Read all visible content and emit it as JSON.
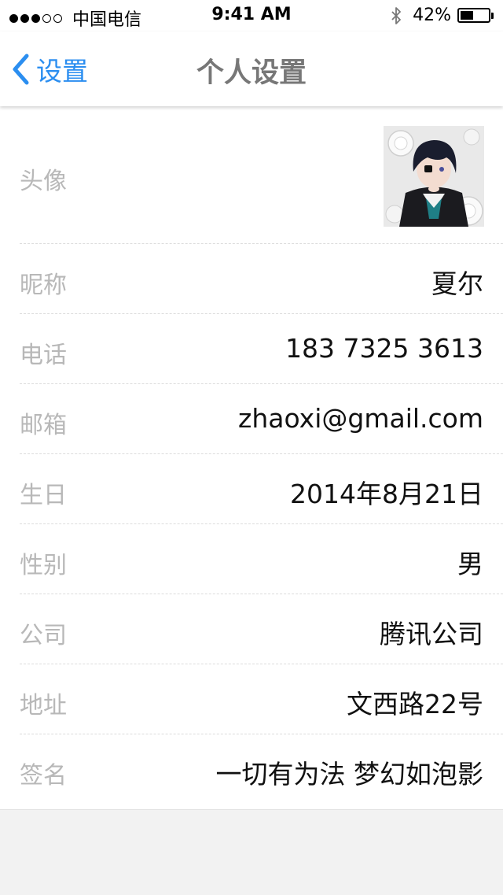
{
  "status_bar": {
    "signal_filled": 3,
    "signal_total": 5,
    "carrier": "中国电信",
    "time": "9:41 AM",
    "battery_percent": "42%",
    "battery_level": 0.42,
    "bluetooth_icon": "bluetooth-icon"
  },
  "nav": {
    "back_label": "设置",
    "title": "个人设置",
    "accent_color": "#2b8ef0"
  },
  "profile": {
    "avatar_label": "头像",
    "rows": [
      {
        "key": "nickname",
        "label": "昵称",
        "value": "夏尔"
      },
      {
        "key": "phone",
        "label": "电话",
        "value": "183 7325 3613"
      },
      {
        "key": "email",
        "label": "邮箱",
        "value": "zhaoxi@gmail.com"
      },
      {
        "key": "birthday",
        "label": "生日",
        "value": "2014年8月21日"
      },
      {
        "key": "gender",
        "label": "性别",
        "value": "男"
      },
      {
        "key": "company",
        "label": "公司",
        "value": "腾讯公司"
      },
      {
        "key": "address",
        "label": "地址",
        "value": "文西路22号"
      },
      {
        "key": "signature",
        "label": "签名",
        "value": "一切有为法 梦幻如泡影"
      }
    ]
  }
}
